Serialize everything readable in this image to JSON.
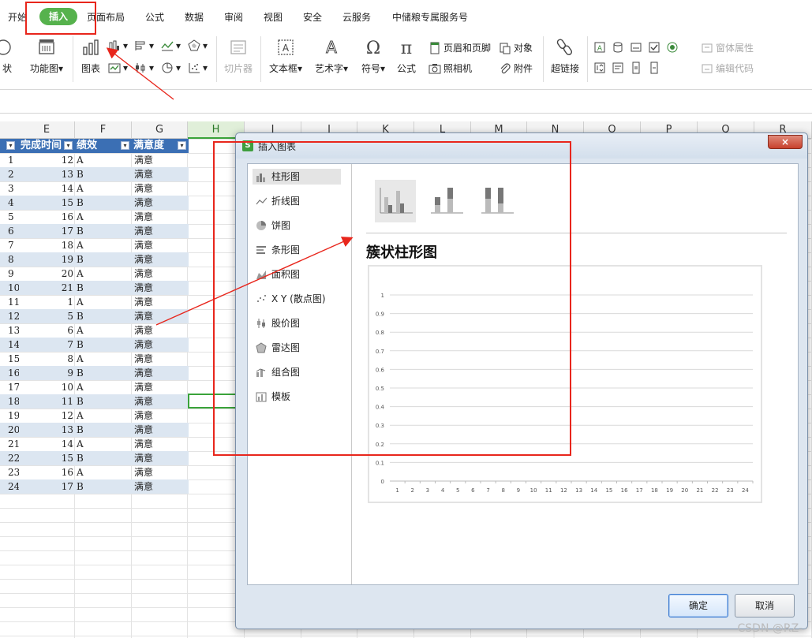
{
  "tabs": [
    {
      "label": "开始"
    },
    {
      "label": "插入",
      "active": true
    },
    {
      "label": "页面布局"
    },
    {
      "label": "公式"
    },
    {
      "label": "数据"
    },
    {
      "label": "审阅"
    },
    {
      "label": "视图"
    },
    {
      "label": "安全"
    },
    {
      "label": "云服务"
    },
    {
      "label": "中储粮专属服务号"
    }
  ],
  "ribbon": {
    "shape_label": "状",
    "function_chart_label": "功能图",
    "chart_label": "图表",
    "clipper_label": "切片器",
    "textbox_label": "文本框",
    "wordart_label": "艺术字",
    "symbol_label": "符号",
    "formula_label": "公式",
    "header_footer_label": "页眉和页脚",
    "object_label": "对象",
    "camera_label": "照相机",
    "attachment_label": "附件",
    "hyperlink_label": "超链接",
    "form_props_label": "窗体属性",
    "edit_code_label": "编辑代码"
  },
  "columns": [
    "E",
    "F",
    "G",
    "H",
    "I",
    "J",
    "K",
    "L",
    "M",
    "N",
    "O",
    "P",
    "Q",
    "R"
  ],
  "selected_column": "H",
  "table": {
    "headers": [
      "完成时间",
      "绩效",
      "满意度"
    ],
    "rows": [
      [
        "1",
        "12",
        "A",
        "满意"
      ],
      [
        "2",
        "13",
        "B",
        "满意"
      ],
      [
        "3",
        "14",
        "A",
        "满意"
      ],
      [
        "4",
        "15",
        "B",
        "满意"
      ],
      [
        "5",
        "16",
        "A",
        "满意"
      ],
      [
        "6",
        "17",
        "B",
        "满意"
      ],
      [
        "7",
        "18",
        "A",
        "满意"
      ],
      [
        "8",
        "19",
        "B",
        "满意"
      ],
      [
        "9",
        "20",
        "A",
        "满意"
      ],
      [
        "10",
        "21",
        "B",
        "满意"
      ],
      [
        "11",
        "1",
        "A",
        "满意"
      ],
      [
        "12",
        "5",
        "B",
        "满意"
      ],
      [
        "13",
        "6",
        "A",
        "满意"
      ],
      [
        "14",
        "7",
        "B",
        "满意"
      ],
      [
        "15",
        "8",
        "A",
        "满意"
      ],
      [
        "16",
        "9",
        "B",
        "满意"
      ],
      [
        "17",
        "10",
        "A",
        "满意"
      ],
      [
        "18",
        "11",
        "B",
        "满意"
      ],
      [
        "19",
        "12",
        "A",
        "满意"
      ],
      [
        "20",
        "13",
        "B",
        "满意"
      ],
      [
        "21",
        "14",
        "A",
        "满意"
      ],
      [
        "22",
        "15",
        "B",
        "满意"
      ],
      [
        "23",
        "16",
        "A",
        "满意"
      ],
      [
        "24",
        "17",
        "B",
        "满意"
      ]
    ]
  },
  "dialog": {
    "title": "插入图表",
    "close_label": "×",
    "categories": [
      {
        "label": "柱形图",
        "icon": "column-chart-icon",
        "selected": true
      },
      {
        "label": "折线图",
        "icon": "line-chart-icon"
      },
      {
        "label": "饼图",
        "icon": "pie-chart-icon"
      },
      {
        "label": "条形图",
        "icon": "bar-chart-icon"
      },
      {
        "label": "面积图",
        "icon": "area-chart-icon"
      },
      {
        "label": "X Y (散点图)",
        "icon": "scatter-chart-icon"
      },
      {
        "label": "股价图",
        "icon": "stock-chart-icon"
      },
      {
        "label": "雷达图",
        "icon": "radar-chart-icon"
      },
      {
        "label": "组合图",
        "icon": "combo-chart-icon"
      },
      {
        "label": "模板",
        "icon": "template-icon"
      }
    ],
    "subtypes": [
      "clustered-column",
      "stacked-column",
      "percent-stacked-column"
    ],
    "chart_title": "簇状柱形图",
    "ok_label": "确定",
    "cancel_label": "取消"
  },
  "chart_data": {
    "type": "bar",
    "title": "簇状柱形图",
    "categories": [
      "1",
      "2",
      "3",
      "4",
      "5",
      "6",
      "7",
      "8",
      "9",
      "10",
      "11",
      "12",
      "13",
      "14",
      "15",
      "16",
      "17",
      "18",
      "19",
      "20",
      "21",
      "22",
      "23",
      "24"
    ],
    "series": [],
    "ylim": [
      0,
      1
    ],
    "yticks": [
      "0",
      "0.1",
      "0.2",
      "0.3",
      "0.4",
      "0.5",
      "0.6",
      "0.7",
      "0.8",
      "0.9",
      "1"
    ],
    "grid": true
  },
  "watermark": "CSDN @RZ-"
}
